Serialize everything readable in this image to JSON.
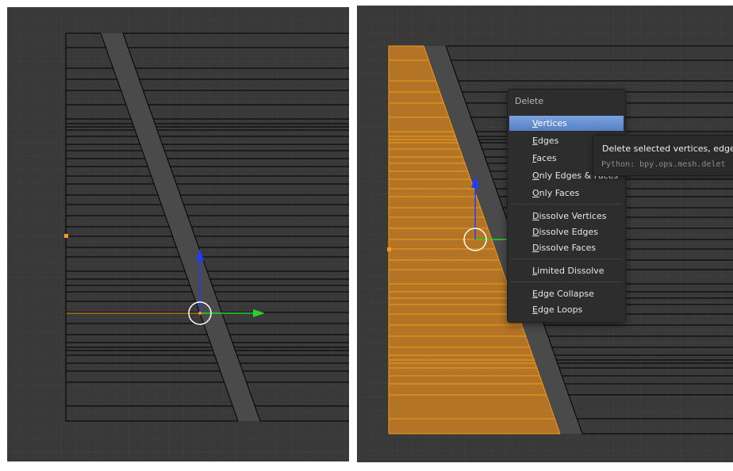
{
  "viewport_left": {
    "state": "edit-mode-unselected",
    "gizmo_axes": [
      "z-blue",
      "y-green",
      "x-orange"
    ]
  },
  "viewport_right": {
    "state": "edit-mode-selected-faces"
  },
  "delete_menu": {
    "title": "Delete",
    "groups": [
      [
        {
          "label": "Vertices",
          "highlighted": true
        },
        {
          "label": "Edges"
        },
        {
          "label": "Faces"
        },
        {
          "label": "Only Edges & Faces"
        },
        {
          "label": "Only Faces"
        }
      ],
      [
        {
          "label": "Dissolve Vertices"
        },
        {
          "label": "Dissolve Edges"
        },
        {
          "label": "Dissolve Faces"
        }
      ],
      [
        {
          "label": "Limited Dissolve"
        }
      ],
      [
        {
          "label": "Edge Collapse"
        },
        {
          "label": "Edge Loops"
        }
      ]
    ]
  },
  "tooltip": {
    "description": "Delete selected vertices, edges",
    "python": "Python: bpy.ops.mesh.delet"
  },
  "colors": {
    "viewport_bg": "#393939",
    "grid_line": "#414141",
    "mesh_wire": "#000000",
    "selection_orange": "#f29b1d",
    "highlight_blue": "#5680c2",
    "axis_blue": "#1f3cff",
    "axis_green": "#28d428"
  }
}
